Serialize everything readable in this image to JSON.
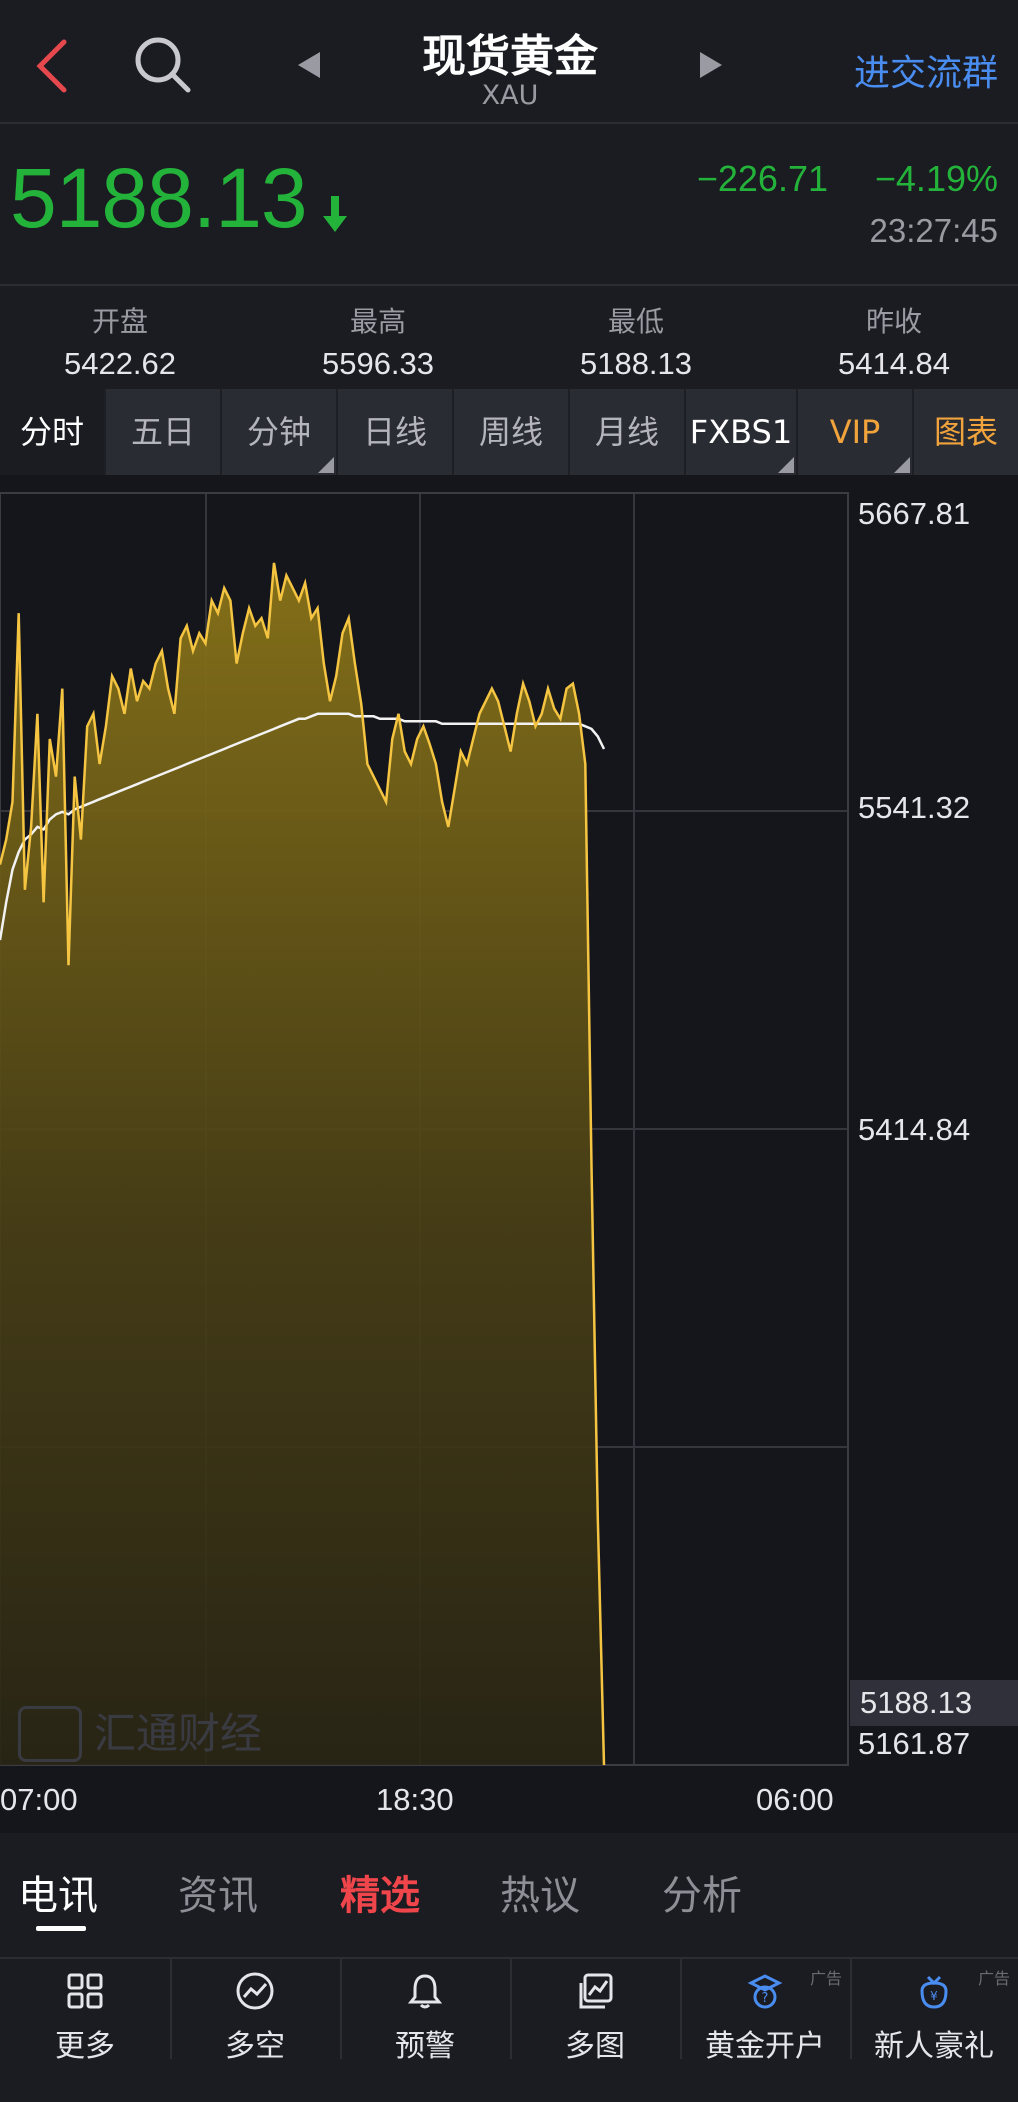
{
  "header": {
    "title": "现货黄金",
    "subtitle": "XAU",
    "group_link": "进交流群"
  },
  "quote": {
    "price": "5188.13",
    "change": "−226.71",
    "change_pct": "−4.19%",
    "time": "23:27:45",
    "direction": "down",
    "color_down": "#24b33a"
  },
  "stats": [
    {
      "label": "开盘",
      "value": "5422.62"
    },
    {
      "label": "最高",
      "value": "5596.33"
    },
    {
      "label": "最低",
      "value": "5188.13"
    },
    {
      "label": "昨收",
      "value": "5414.84"
    }
  ],
  "period_tabs": [
    {
      "label": "分时",
      "active": true
    },
    {
      "label": "五日"
    },
    {
      "label": "分钟",
      "dropdown": true
    },
    {
      "label": "日线"
    },
    {
      "label": "周线"
    },
    {
      "label": "月线"
    },
    {
      "label": "FXBS1",
      "dropdown": true
    },
    {
      "label": "VIP",
      "dropdown": true
    },
    {
      "label": "图表"
    }
  ],
  "chart_data": {
    "type": "area",
    "y_ticks": [
      "5667.81",
      "5541.32",
      "5414.84",
      "5188.13",
      "5161.87"
    ],
    "x_ticks": [
      "07:00",
      "18:30",
      "06:00"
    ],
    "last_price_label": "5188.13",
    "ylim": [
      5161.87,
      5667.81
    ],
    "colors": {
      "price_line": "#f5c542",
      "avg_line": "#ffffff",
      "fill": "#7a6a18"
    },
    "series": [
      {
        "values": [
          5520,
          5530,
          5545,
          5620,
          5510,
          5535,
          5580,
          5505,
          5570,
          5555,
          5590,
          5480,
          5555,
          5530,
          5575,
          5580,
          5560,
          5575,
          5595,
          5590,
          5580,
          5598,
          5585,
          5593,
          5590,
          5600,
          5605,
          5590,
          5580,
          5610,
          5615,
          5605,
          5612,
          5608,
          5625,
          5620,
          5630,
          5625,
          5600,
          5612,
          5622,
          5615,
          5618,
          5610,
          5640,
          5625,
          5635,
          5630,
          5625,
          5632,
          5618,
          5622,
          5600,
          5585,
          5595,
          5612,
          5618,
          5600,
          5584,
          5560,
          5555,
          5550,
          5545,
          5570,
          5580,
          5565,
          5560,
          5570,
          5575,
          5568,
          5560,
          5545,
          5535,
          5550,
          5565,
          5560,
          5570,
          5580,
          5585,
          5590,
          5585,
          5575,
          5565,
          5580,
          5592,
          5585,
          5575,
          5580,
          5590,
          5582,
          5578,
          5590,
          5592,
          5580,
          5560,
          5400,
          5260,
          5161.87
        ],
        "avg": [
          5490,
          5505,
          5518,
          5525,
          5530,
          5532,
          5535,
          5534,
          5538,
          5540,
          5541,
          5540,
          5542,
          5543,
          5544,
          5545,
          5546,
          5547,
          5548,
          5549,
          5550,
          5551,
          5552,
          5553,
          5554,
          5555,
          5556,
          5557,
          5558,
          5559,
          5560,
          5561,
          5562,
          5563,
          5564,
          5565,
          5566,
          5567,
          5568,
          5569,
          5570,
          5571,
          5572,
          5573,
          5574,
          5575,
          5576,
          5577,
          5578,
          5578,
          5579,
          5580,
          5580,
          5580,
          5580,
          5580,
          5580,
          5579,
          5579,
          5579,
          5579,
          5578,
          5578,
          5578,
          5578,
          5577,
          5577,
          5577,
          5577,
          5577,
          5577,
          5576,
          5576,
          5576,
          5576,
          5576,
          5576,
          5576,
          5576,
          5576,
          5576,
          5576,
          5576,
          5576,
          5576,
          5576,
          5576,
          5576,
          5576,
          5576,
          5576,
          5576,
          5576,
          5576,
          5575,
          5574,
          5571,
          5566
        ]
      }
    ]
  },
  "watermark": "汇通财经",
  "news_tabs": [
    {
      "label": "电讯",
      "state": "active"
    },
    {
      "label": "资讯"
    },
    {
      "label": "精选",
      "state": "hot"
    },
    {
      "label": "热议"
    },
    {
      "label": "分析"
    }
  ],
  "bottom_bar": [
    {
      "label": "更多",
      "icon": "grid-icon"
    },
    {
      "label": "多空",
      "icon": "trend-icon"
    },
    {
      "label": "预警",
      "icon": "bell-icon"
    },
    {
      "label": "多图",
      "icon": "multi-chart-icon"
    },
    {
      "label": "黄金开户",
      "icon": "account-icon",
      "ad": "广告"
    },
    {
      "label": "新人豪礼",
      "icon": "gift-icon",
      "ad": "广告"
    }
  ]
}
